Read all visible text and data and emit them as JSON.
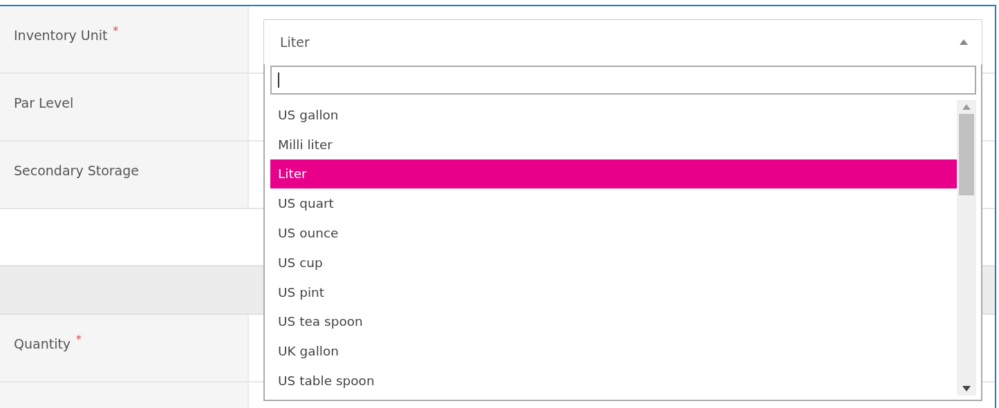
{
  "form": {
    "top_fields": [
      {
        "label": "Inventory Unit",
        "required_mark": "*"
      },
      {
        "label": "Par Level"
      },
      {
        "label": "Secondary Storage"
      }
    ],
    "lower_fields": [
      {
        "label": "Quantity",
        "required_mark": "*"
      }
    ]
  },
  "unit_select": {
    "value": "Liter",
    "expanded": true,
    "options": [
      {
        "label": "US gallon",
        "selected": false
      },
      {
        "label": "Milli liter",
        "selected": false
      },
      {
        "label": "Liter",
        "selected": true
      },
      {
        "label": "US quart",
        "selected": false
      },
      {
        "label": "US ounce",
        "selected": false
      },
      {
        "label": "US cup",
        "selected": false
      },
      {
        "label": "US pint",
        "selected": false
      },
      {
        "label": "US tea spoon",
        "selected": false
      },
      {
        "label": "UK gallon",
        "selected": false
      },
      {
        "label": "US table spoon",
        "selected": false
      }
    ]
  }
}
